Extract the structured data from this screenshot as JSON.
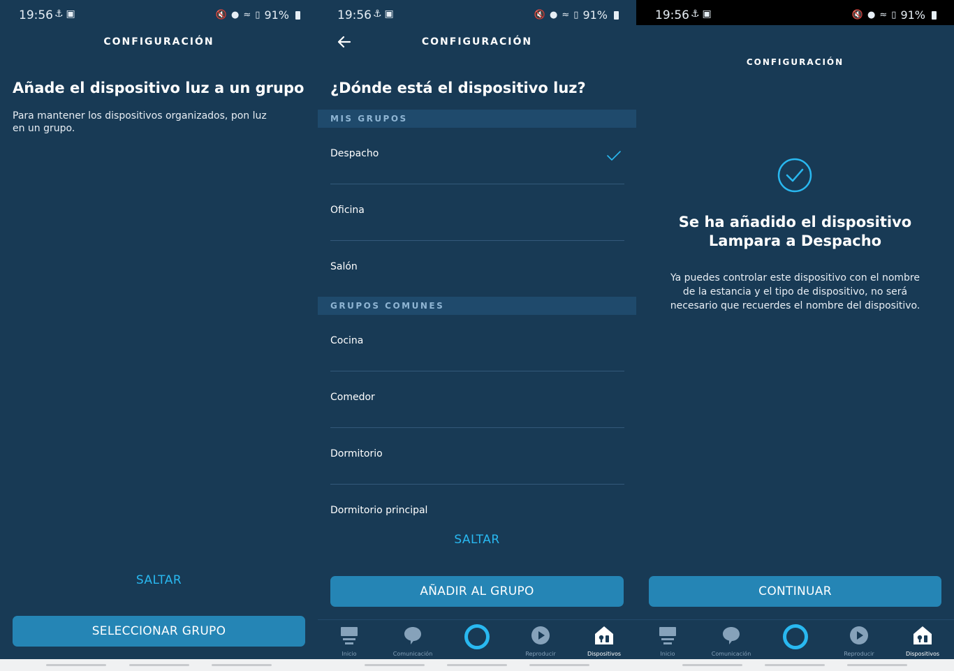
{
  "status_bar": {
    "time": "19:56",
    "battery": "91%"
  },
  "panel1": {
    "header_title": "CONFIGURACIÓN",
    "title": "Añade el dispositivo luz a un grupo",
    "subtitle": "Para mantener los dispositivos organizados, pon luz en un grupo.",
    "skip_label": "SALTAR",
    "primary_label": "SELECCIONAR GRUPO"
  },
  "panel2": {
    "header_title": "CONFIGURACIÓN",
    "title": "¿Dónde está el dispositivo luz?",
    "my_groups_header": "MIS GRUPOS",
    "my_groups": [
      {
        "label": "Despacho",
        "selected": true
      },
      {
        "label": "Oficina",
        "selected": false
      },
      {
        "label": "Salón",
        "selected": false
      }
    ],
    "common_groups_header": "GRUPOS COMUNES",
    "common_groups": [
      {
        "label": "Cocina"
      },
      {
        "label": "Comedor"
      },
      {
        "label": "Dormitorio"
      },
      {
        "label": "Dormitorio principal"
      }
    ],
    "skip_label": "SALTAR",
    "primary_label": "AÑADIR AL GRUPO"
  },
  "panel3": {
    "header_title": "CONFIGURACIÓN",
    "success_title_line1": "Se ha añadido el dispositivo",
    "success_title_line2": "Lampara a Despacho",
    "success_message": "Ya puedes controlar este dispositivo con el nombre de la estancia y el tipo de dispositivo, no será necesario que recuerdes el nombre del dispositivo.",
    "primary_label": "CONTINUAR"
  },
  "nav": {
    "items": [
      {
        "label": "Inicio",
        "icon": "home-icon"
      },
      {
        "label": "Comunicación",
        "icon": "chat-icon"
      },
      {
        "label": "",
        "icon": "alexa-ring-icon"
      },
      {
        "label": "Reproducir",
        "icon": "play-icon"
      },
      {
        "label": "Dispositivos",
        "icon": "devices-icon",
        "active": true
      }
    ]
  },
  "colors": {
    "background": "#183a55",
    "accent": "#29b8f0",
    "button": "#2585b5",
    "section_header_bg": "#1f4a6c"
  }
}
